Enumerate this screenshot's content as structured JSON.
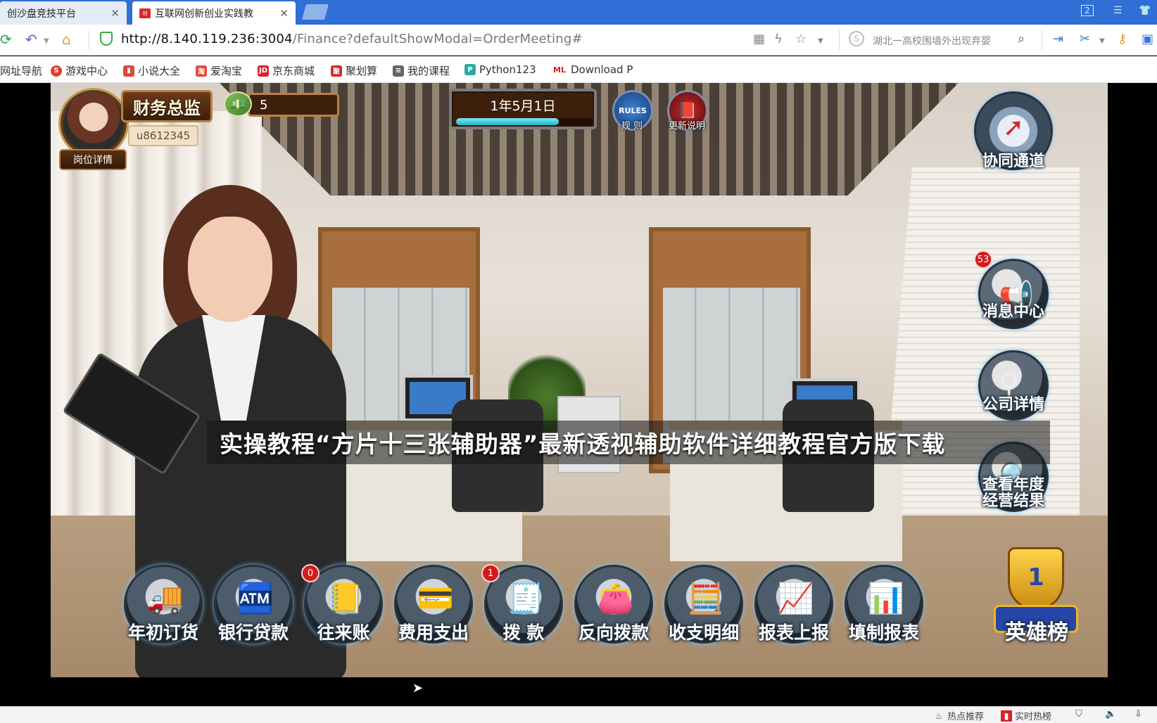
{
  "browser": {
    "tabs": [
      {
        "title": "创沙盘竞技平台",
        "active": false
      },
      {
        "title": "互联网创新创业实践教",
        "active": true,
        "favicon_text": "创"
      }
    ],
    "url_host": "http://8.140.119.236:3004",
    "url_path": "/Finance?defaultShowModal=OrderMeeting#",
    "search_hint": "湖北一高校围墙外出现弃婴",
    "window_badge": "2",
    "accent_color": "#2f6fd6",
    "bookmarks": [
      {
        "label": "网址导航",
        "icon": "nav-icon",
        "color": "#3a78d8"
      },
      {
        "label": "游戏中心",
        "icon": "game-icon",
        "color": "#e23b2e"
      },
      {
        "label": "小说大全",
        "icon": "book-icon",
        "color": "#e0483c"
      },
      {
        "label": "爱淘宝",
        "icon": "taobao-icon",
        "color": "#e5473b"
      },
      {
        "label": "京东商城",
        "icon": "jd-icon",
        "color": "#d8232a"
      },
      {
        "label": "聚划算",
        "icon": "juhuasuan-icon",
        "color": "#d8232a"
      },
      {
        "label": "我的课程",
        "icon": "course-icon",
        "color": "#666"
      },
      {
        "label": "Python123",
        "icon": "python-icon",
        "color": "#2eaa9e"
      },
      {
        "label": "Download P",
        "icon": "ml-icon",
        "color": "#d8232a",
        "icon_text": "ML"
      }
    ]
  },
  "game": {
    "role": "财务总监",
    "user_id": "u8612345",
    "role_detail_btn": "岗位详情",
    "money": "5",
    "date": "1年5月1日",
    "date_progress": 0.75,
    "rules_btn": {
      "icon_text": "RULES",
      "label": "规 则"
    },
    "update_btn": {
      "label": "更新说明"
    },
    "side_buttons": [
      {
        "label": "协同通道",
        "icon": "compass-icon"
      },
      {
        "label": "消息中心",
        "icon": "megaphone-icon",
        "badge": "53"
      },
      {
        "label": "公司详情",
        "icon": "magnifier-icon"
      },
      {
        "label": "查看年度经营结果",
        "line1": "查看年度",
        "line2": "经营结果",
        "icon": "chart-board-icon"
      }
    ],
    "bottom_buttons": [
      {
        "label": "年初订货",
        "icon": "truck-icon",
        "glyph": "🚚"
      },
      {
        "label": "银行贷款",
        "icon": "atm-icon",
        "glyph": "🏧"
      },
      {
        "label": "往来账",
        "icon": "ledger-icon",
        "glyph": "📒",
        "badge": "0"
      },
      {
        "label": "费用支出",
        "icon": "card-icon",
        "glyph": "💳"
      },
      {
        "label": "拨 款",
        "icon": "cheque-icon",
        "glyph": "🧾",
        "badge": "1"
      },
      {
        "label": "反向拨款",
        "icon": "wallet-icon",
        "glyph": "👛"
      },
      {
        "label": "收支明细",
        "icon": "register-icon",
        "glyph": "🧮"
      },
      {
        "label": "报表上报",
        "icon": "presentation-icon",
        "glyph": "📈"
      },
      {
        "label": "填制报表",
        "icon": "bar-chart-icon",
        "glyph": "📊"
      }
    ],
    "leaderboard": {
      "label": "英雄榜",
      "icon": "trophy-icon",
      "rank_text": "1"
    }
  },
  "overlay_title": "实操教程“方片十三张辅助器”最新透视辅助软件详细教程官方版下载",
  "statusbar": {
    "items": [
      {
        "label": "热点推荐",
        "icon": "hot-icon"
      },
      {
        "label": "实时热榜",
        "icon": "rank-icon"
      }
    ]
  }
}
